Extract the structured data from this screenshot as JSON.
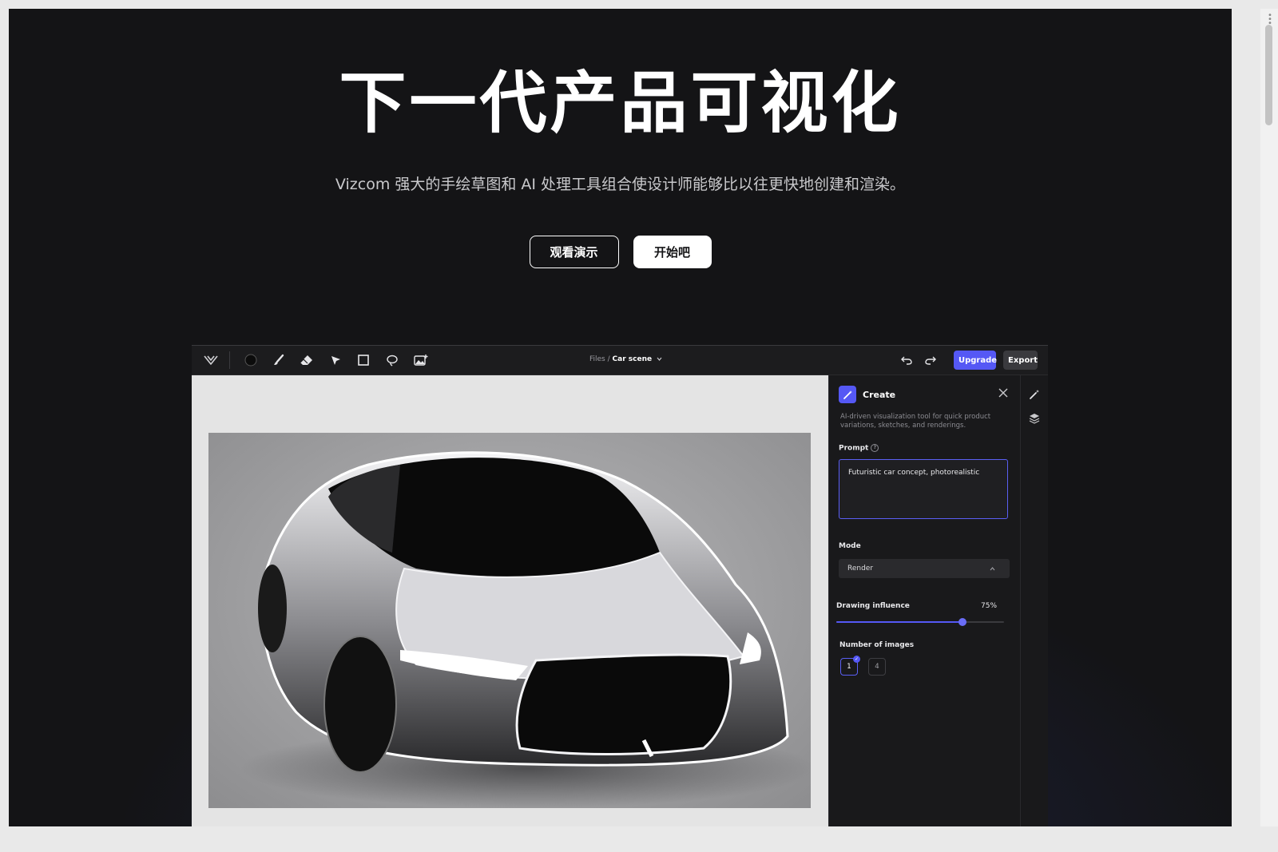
{
  "hero": {
    "title": "下一代产品可视化",
    "subtitle": "Vizcom 强大的手绘草图和 AI 处理工具组合使设计师能够比以往更快地创建和渲染。",
    "btn_demo": "观看演示",
    "btn_start": "开始吧"
  },
  "app": {
    "breadcrumb_parent": "Files /",
    "breadcrumb_current": "Car scene",
    "upgrade_label": "Upgrade",
    "export_label": "Export",
    "panel": {
      "title": "Create",
      "description": "AI-driven visualization tool for quick product variations, sketches, and renderings.",
      "prompt_label": "Prompt",
      "prompt_value": "Futuristic car concept, photorealistic",
      "mode_label": "Mode",
      "mode_value": "Render",
      "influence_label": "Drawing influence",
      "influence_value": "75%",
      "influence_fraction": 0.75,
      "images_label": "Number of images",
      "image_options": [
        "1",
        "4"
      ],
      "selected_option": "1"
    }
  },
  "colors": {
    "accent": "#5558f5",
    "background": "#141416",
    "panel": "#19191b"
  },
  "icons": [
    "vizcom-logo-icon",
    "color-swatch-icon",
    "brush-icon",
    "eraser-icon",
    "select-arrow-icon",
    "rectangle-icon",
    "lasso-icon",
    "image-add-icon",
    "chevron-down-icon",
    "undo-icon",
    "redo-icon",
    "magic-wand-icon",
    "close-icon",
    "help-icon",
    "layers-icon",
    "check-icon"
  ]
}
